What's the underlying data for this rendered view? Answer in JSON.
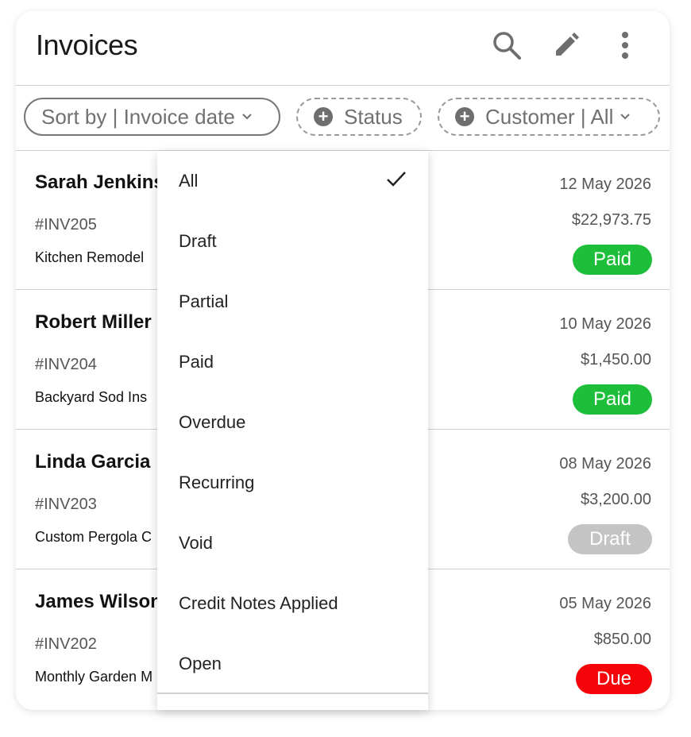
{
  "header": {
    "title": "Invoices",
    "icons": [
      "search-icon",
      "edit-pencil-icon",
      "more-vertical-icon"
    ]
  },
  "filters": {
    "sort": {
      "label": "Sort by | Invoice date"
    },
    "status": {
      "label": "Status"
    },
    "customer": {
      "label": "Customer | All"
    }
  },
  "invoices": [
    {
      "customer": "Sarah Jenkins",
      "number": "#INV205",
      "description": "Kitchen Remodel",
      "date": "12 May 2026",
      "amount": "$22,973.75",
      "status": "Paid",
      "status_color": "#1dbf3a"
    },
    {
      "customer": "Robert Miller",
      "number": "#INV204",
      "description": "Backyard Sod Ins",
      "date": "10 May 2026",
      "amount": "$1,450.00",
      "status": "Paid",
      "status_color": "#1dbf3a"
    },
    {
      "customer": "Linda Garcia",
      "number": "#INV203",
      "description": "Custom Pergola C",
      "date": "08 May 2026",
      "amount": "$3,200.00",
      "status": "Draft",
      "status_color": "#c4c4c4"
    },
    {
      "customer": "James Wilson",
      "number": "#INV202",
      "description": "Monthly Garden M",
      "date": "05 May 2026",
      "amount": "$850.00",
      "status": "Due",
      "status_color": "#f5050a"
    }
  ],
  "status_dropdown": {
    "selected": "All",
    "options": [
      "All",
      "Draft",
      "Partial",
      "Paid",
      "Overdue",
      "Recurring",
      "Void",
      "Credit Notes Applied",
      "Open"
    ]
  }
}
